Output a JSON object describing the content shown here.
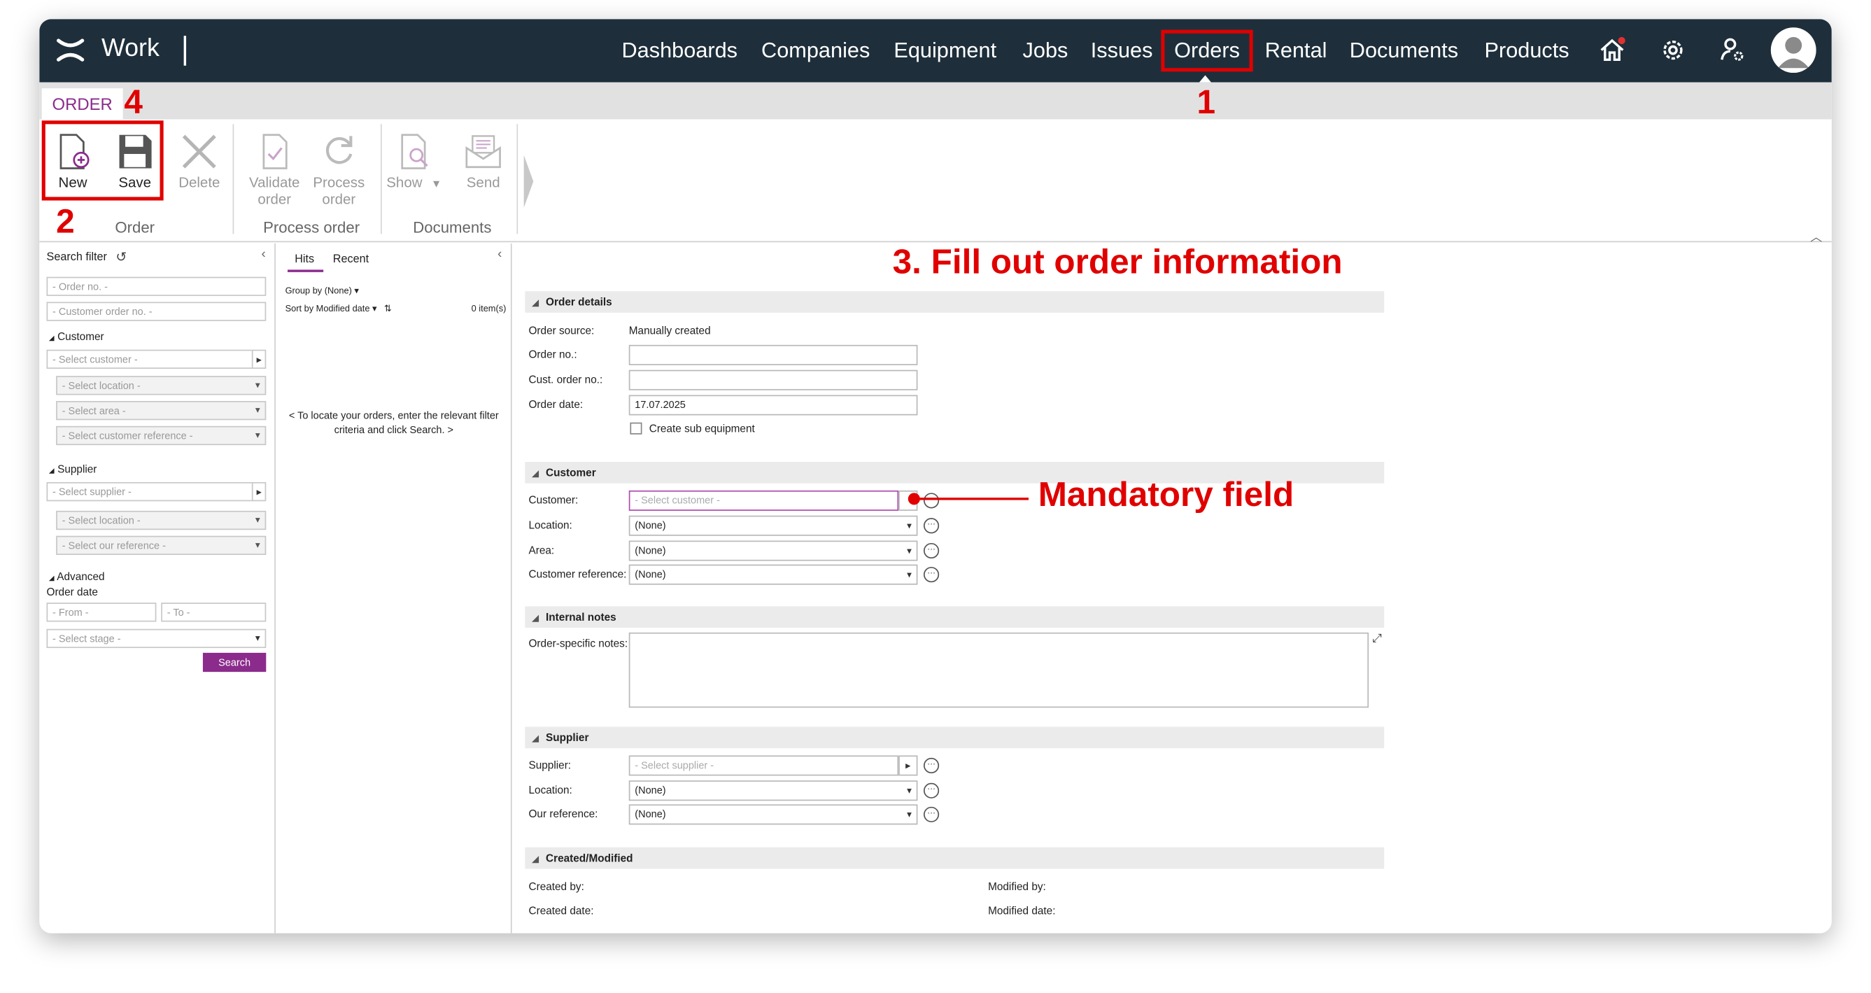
{
  "app": {
    "brand": "Work"
  },
  "nav": {
    "items": [
      "Dashboards",
      "Companies",
      "Equipment",
      "Jobs",
      "Issues",
      "Orders",
      "Rental",
      "Documents",
      "Products"
    ],
    "active": "Orders"
  },
  "toolbar": {
    "tab": "ORDER",
    "new_label": "New",
    "save_label": "Save",
    "delete_label": "Delete",
    "validate_label": [
      "Validate",
      "order"
    ],
    "process_label": [
      "Process",
      "order"
    ],
    "show_label": "Show",
    "send_label": "Send",
    "groups": [
      "Order",
      "Process order",
      "Documents"
    ]
  },
  "filter": {
    "title": "Search filter",
    "order_no_placeholder": "- Order no. -",
    "cust_order_no_placeholder": "- Customer order no. -",
    "customer_section": "Customer",
    "select_customer": "- Select customer -",
    "select_location": "- Select location -",
    "select_area": "- Select area -",
    "select_customer_reference": "- Select customer reference -",
    "supplier_section": "Supplier",
    "select_supplier": "- Select supplier -",
    "select_location_2": "- Select location -",
    "select_our_reference": "- Select our reference -",
    "advanced_section": "Advanced",
    "order_date_label": "Order date",
    "from_placeholder": "- From -",
    "to_placeholder": "- To -",
    "select_stage": "- Select stage -",
    "search_button": "Search"
  },
  "results": {
    "tabs": [
      "Hits",
      "Recent"
    ],
    "group_by": "Group by (None)",
    "sort_by": "Sort by Modified date",
    "count": "0 item(s)",
    "empty_message": [
      "< To locate your orders, enter the relevant filter",
      "criteria and click Search. >"
    ]
  },
  "form": {
    "order_details": {
      "title": "Order details",
      "order_source_label": "Order source:",
      "order_source_value": "Manually created",
      "order_no_label": "Order no.:",
      "cust_order_no_label": "Cust. order no.:",
      "order_date_label": "Order date:",
      "order_date_value": "17.07.2025",
      "create_sub_label": "Create sub equipment"
    },
    "customer": {
      "title": "Customer",
      "customer_label": "Customer:",
      "customer_placeholder": "- Select customer -",
      "location_label": "Location:",
      "location_value": "(None)",
      "area_label": "Area:",
      "area_value": "(None)",
      "reference_label": "Customer reference:",
      "reference_value": "(None)"
    },
    "internal_notes": {
      "title": "Internal notes",
      "notes_label": "Order-specific notes:"
    },
    "supplier": {
      "title": "Supplier",
      "supplier_label": "Supplier:",
      "supplier_placeholder": "- Select supplier -",
      "location_label": "Location:",
      "location_value": "(None)",
      "our_reference_label": "Our reference:",
      "our_reference_value": "(None)"
    },
    "created_modified": {
      "title": "Created/Modified",
      "created_by_label": "Created by:",
      "created_date_label": "Created date:",
      "modified_by_label": "Modified by:",
      "modified_date_label": "Modified date:"
    }
  },
  "annotations": {
    "step1": "1",
    "step2": "2",
    "step3": "3. Fill out order information",
    "step4": "4",
    "mandatory": "Mandatory field"
  },
  "colors": {
    "topbar": "#1e2f3b",
    "accent": "#8b2b8c",
    "annotation": "#e00000"
  }
}
